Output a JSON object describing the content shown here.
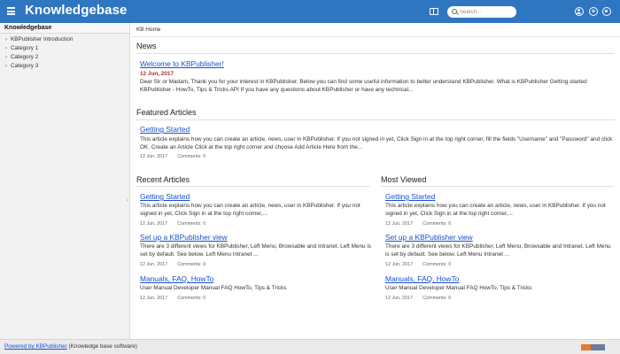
{
  "header": {
    "title": "Knowledgebase",
    "search_placeholder": "Search...",
    "icons": [
      "menu-icon",
      "book-icon",
      "search-icon",
      "user-icon",
      "plus-icon",
      "gear-icon"
    ],
    "colors": {
      "bar": "#2f76c0",
      "link": "#1a4fd0",
      "date_red": "#b32b2b"
    }
  },
  "sidebar": {
    "title": "Knowledgebase",
    "items": [
      {
        "label": "KBPublisher Introduction"
      },
      {
        "label": "Category 1"
      },
      {
        "label": "Category 2"
      },
      {
        "label": "Category 3"
      }
    ]
  },
  "main": {
    "breadcrumb": "KB Home",
    "news": {
      "heading": "News",
      "title": "Welcome to KBPublisher!",
      "date": "12 Jun, 2017",
      "body": "Dear Sir or Madam, Thank you for your interest in KBPublisher. Below you can find some useful information to better understand KBPublisher. What is KBPublisher Getting started KBPublisher - HowTo, Tips & Tricks API If you have any questions about KBPublisher or have any technical..."
    },
    "featured": {
      "heading": "Featured Articles",
      "title": "Getting Started",
      "body": "This article explains how you can create an article, news, user in KBPublisher. If you not signed in yet, Click Sign in at the top right corner, fill the fields \"Username\" and \"Password\" and click OK. Create an Article Click at the top right corner and choose Add Article Here from the...",
      "date": "12 Jun, 2017",
      "comments": "Comments: 0"
    },
    "recent": {
      "heading": "Recent Articles",
      "items": [
        {
          "title": "Getting Started",
          "body": "This article explains how you can create an article, news, user in KBPublisher. If you not signed in yet, Click Sign in at the top right corner,...",
          "date": "12 Jun, 2017",
          "comments": "Comments: 0"
        },
        {
          "title": "Set up a KBPublisher view",
          "body": "There are 3 different views for KBPublisher, Left Menu, Browsable and Intranet. Left Menu is set by default. See below. Left Menu Intranet ...",
          "date": "12 Jun, 2017",
          "comments": "Comments: 0"
        },
        {
          "title": "Manuals, FAQ, HowTo",
          "body": "User Manual Developer Manual FAQ HowTo, Tips & Tricks",
          "date": "12 Jun, 2017",
          "comments": "Comments: 0"
        }
      ]
    },
    "most_viewed": {
      "heading": "Most Viewed",
      "items": [
        {
          "title": "Getting Started",
          "body": "This article explains how you can create an article, news, user in KBPublisher. If you not signed in yet, Click Sign in at the top right corner,...",
          "date": "12 Jun, 2017",
          "comments": "Comments: 0"
        },
        {
          "title": "Set up a KBPublisher view",
          "body": "There are 3 different views for KBPublisher, Left Menu, Browsable and Intranet. Left Menu is set by default. See below. Left Menu Intranet ...",
          "date": "12 Jun, 2017",
          "comments": "Comments: 0"
        },
        {
          "title": "Manuals, FAQ, HowTo",
          "body": "User Manual Developer Manual FAQ HowTo, Tips & Tricks",
          "date": "12 Jun, 2017",
          "comments": "Comments: 0"
        }
      ]
    }
  },
  "footer": {
    "link": "Powered by KBPublisher",
    "text": " (Knowledge base software)"
  }
}
